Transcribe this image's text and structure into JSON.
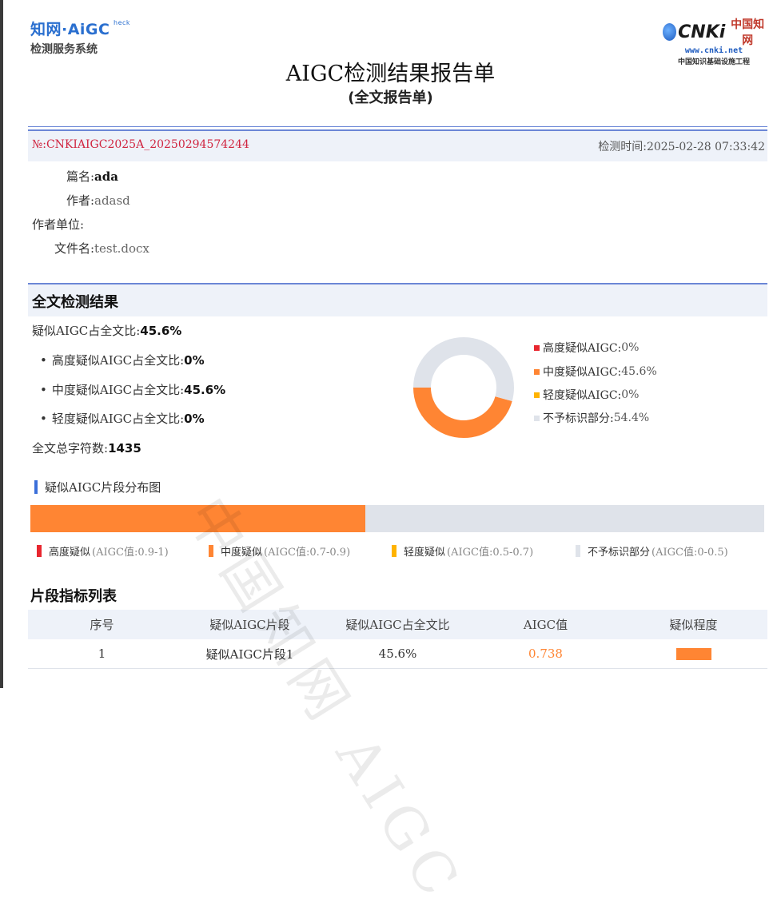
{
  "header": {
    "logo_left_line1": "知网·AiGC",
    "logo_left_check": "heck",
    "logo_left_line2": "检测服务系统",
    "logo_right_brand": "CNKi",
    "logo_right_brand_zh": "中国知网",
    "logo_right_url": "www.cnki.net",
    "logo_right_sub": "中国知识基础设施工程",
    "title": "AIGC检测结果报告单",
    "subtitle": "(全文报告单)"
  },
  "report": {
    "number": "№:CNKIAIGC2025A_20250294574244",
    "check_time_label": "检测时间:",
    "check_time": "2025-02-28 07:33:42"
  },
  "meta": {
    "title_label": "篇名:",
    "title_value": "ada",
    "author_label": "作者:",
    "author_value": "adasd",
    "affiliation_label": "作者单位:",
    "affiliation_value": "",
    "filename_label": "文件名:",
    "filename_value": "test.docx"
  },
  "result": {
    "section_title": "全文检测结果",
    "overall_label": "疑似AIGC占全文比:",
    "overall_value": "45.6%",
    "high_label": "高度疑似AIGC占全文比:",
    "high_value": "0%",
    "medium_label": "中度疑似AIGC占全文比:",
    "medium_value": "45.6%",
    "light_label": "轻度疑似AIGC占全文比:",
    "light_value": "0%",
    "total_chars_label": "全文总字符数:",
    "total_chars_value": "1435"
  },
  "chart_data": {
    "type": "pie",
    "categories": [
      "高度疑似AIGC",
      "中度疑似AIGC",
      "轻度疑似AIGC",
      "不予标识部分"
    ],
    "values": [
      0,
      45.6,
      0,
      54.4
    ],
    "colors": [
      "#e8262f",
      "#ff8533",
      "#ffb300",
      "#dfe3ea"
    ],
    "legend": [
      {
        "label": "高度疑似AIGC:",
        "value": "0%"
      },
      {
        "label": "中度疑似AIGC:",
        "value": "45.6%"
      },
      {
        "label": "轻度疑似AIGC:",
        "value": "0%"
      },
      {
        "label": "不予标识部分:",
        "value": "54.4%"
      }
    ]
  },
  "distribution": {
    "title": "疑似AIGC片段分布图",
    "medium_fraction": 0.456,
    "legend": [
      {
        "label": "高度疑似",
        "range": "(AIGC值:0.9-1)",
        "color": "#e8262f"
      },
      {
        "label": "中度疑似",
        "range": "(AIGC值:0.7-0.9)",
        "color": "#ff8533"
      },
      {
        "label": "轻度疑似",
        "range": "(AIGC值:0.5-0.7)",
        "color": "#ffb300"
      },
      {
        "label": "不予标识部分",
        "range": "(AIGC值:0-0.5)",
        "color": "#dfe3ea"
      }
    ]
  },
  "segments": {
    "title": "片段指标列表",
    "columns": [
      "序号",
      "疑似AIGC片段",
      "疑似AIGC占全文比",
      "AIGC值",
      "疑似程度"
    ],
    "rows": [
      {
        "index": "1",
        "name": "疑似AIGC片段1",
        "ratio": "45.6%",
        "aigc": "0.738",
        "degree_color": "#ff8533"
      }
    ]
  },
  "watermark": "中国知网 AIGC"
}
